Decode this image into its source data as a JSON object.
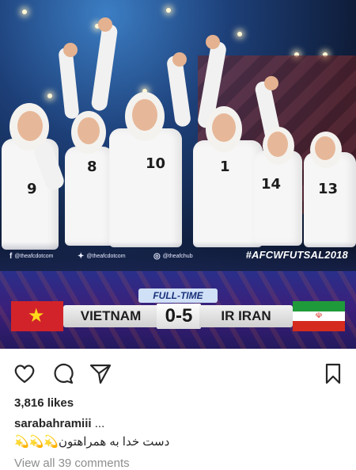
{
  "post": {
    "photo": {
      "jersey_numbers": [
        "9",
        "8",
        "10",
        "1",
        "14",
        "13"
      ],
      "social_handles": [
        {
          "icon": "facebook-icon",
          "text": "@theafcdotcom"
        },
        {
          "icon": "twitter-icon",
          "text": "@theafcdotcom"
        },
        {
          "icon": "instagram-icon",
          "text": "@theafchub"
        }
      ],
      "hashtag": "#AFCWFUTSAL2018"
    },
    "scoreboard": {
      "status": "FULL-TIME",
      "home_team": "VIETNAM",
      "away_team": "IR IRAN",
      "score": "0-5",
      "home_flag": "vietnam-flag",
      "away_flag": "iran-flag"
    }
  },
  "actions": {
    "like_icon": "heart-icon",
    "comment_icon": "comment-icon",
    "share_icon": "send-icon",
    "save_icon": "bookmark-icon"
  },
  "likes": "3,816 likes",
  "caption": {
    "username": "sarabahramiii",
    "more": " ...",
    "text": "💫💫💫دست خدا به همراهتون"
  },
  "comments_link": "View all 39 comments",
  "colors": {
    "text": "#262626",
    "muted": "#8e8e8e",
    "banner": "#2a2f8a"
  }
}
